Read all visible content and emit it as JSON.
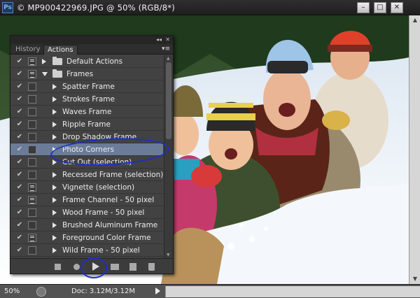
{
  "window": {
    "app_icon": "Ps",
    "title": "© MP900422969.JPG @ 50% (RGB/8*)",
    "minimize": "–",
    "maximize": "□",
    "close": "✕"
  },
  "panel": {
    "collapse_glyph": "◂◂",
    "close_glyph": "✕",
    "tabs": [
      {
        "label": "History",
        "active": false
      },
      {
        "label": "Actions",
        "active": true
      }
    ],
    "menu_glyph": "▾≡",
    "actions": [
      {
        "label": "Default Actions",
        "checked": true,
        "dialog": true,
        "kind": "set",
        "expanded": false
      },
      {
        "label": "Frames",
        "checked": true,
        "dialog": true,
        "kind": "set",
        "expanded": true
      },
      {
        "label": "Spatter Frame",
        "checked": true,
        "dialog": false,
        "kind": "action"
      },
      {
        "label": "Strokes Frame",
        "checked": true,
        "dialog": false,
        "kind": "action"
      },
      {
        "label": "Waves Frame",
        "checked": true,
        "dialog": false,
        "kind": "action"
      },
      {
        "label": "Ripple Frame",
        "checked": true,
        "dialog": false,
        "kind": "action"
      },
      {
        "label": "Drop Shadow Frame",
        "checked": true,
        "dialog": false,
        "kind": "action"
      },
      {
        "label": "Photo Corners",
        "checked": true,
        "dialog": false,
        "kind": "action",
        "selected": true
      },
      {
        "label": "Cut Out (selection)",
        "checked": true,
        "dialog": false,
        "kind": "action"
      },
      {
        "label": "Recessed Frame (selection)",
        "checked": true,
        "dialog": false,
        "kind": "action"
      },
      {
        "label": "Vignette (selection)",
        "checked": true,
        "dialog": true,
        "kind": "action"
      },
      {
        "label": "Frame Channel - 50 pixel",
        "checked": true,
        "dialog": true,
        "kind": "action"
      },
      {
        "label": "Wood Frame - 50 pixel",
        "checked": true,
        "dialog": false,
        "kind": "action"
      },
      {
        "label": "Brushed Aluminum Frame",
        "checked": true,
        "dialog": false,
        "kind": "action"
      },
      {
        "label": "Foreground Color Frame",
        "checked": true,
        "dialog": true,
        "kind": "action"
      },
      {
        "label": "Wild Frame - 50 pixel",
        "checked": true,
        "dialog": false,
        "kind": "action"
      }
    ],
    "check_glyph": "✔"
  },
  "status": {
    "zoom": "50%",
    "doc_size": "Doc: 3.12M/3.12M"
  },
  "colors": {
    "selected_row": "#6a7c98",
    "annotation": "#1c2fc8",
    "panel_bg": "#424242"
  }
}
